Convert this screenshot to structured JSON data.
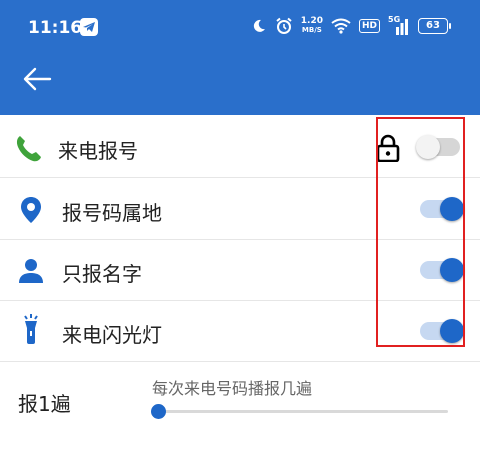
{
  "status_bar": {
    "time": "11:16",
    "net_speed_value": "1.20",
    "net_speed_unit": "MB/S",
    "hd": "HD",
    "signal": "5G",
    "battery": "63"
  },
  "settings": [
    {
      "label": "来电报号",
      "icon": "phone-icon",
      "enabled": false,
      "locked": true
    },
    {
      "label": "报号码属地",
      "icon": "location-pin-icon",
      "enabled": true
    },
    {
      "label": "只报名字",
      "icon": "person-icon",
      "enabled": true
    },
    {
      "label": "来电闪光灯",
      "icon": "flashlight-icon",
      "enabled": true
    }
  ],
  "repeat": {
    "label": "报1遍",
    "hint": "每次来电号码播报几遍",
    "value": 1,
    "min": 1,
    "max": 10
  },
  "colors": {
    "appbar": "#2a6fcb",
    "accent": "#1e67c8",
    "phone_icon": "#3fa33b",
    "highlight_box": "#e12020"
  }
}
